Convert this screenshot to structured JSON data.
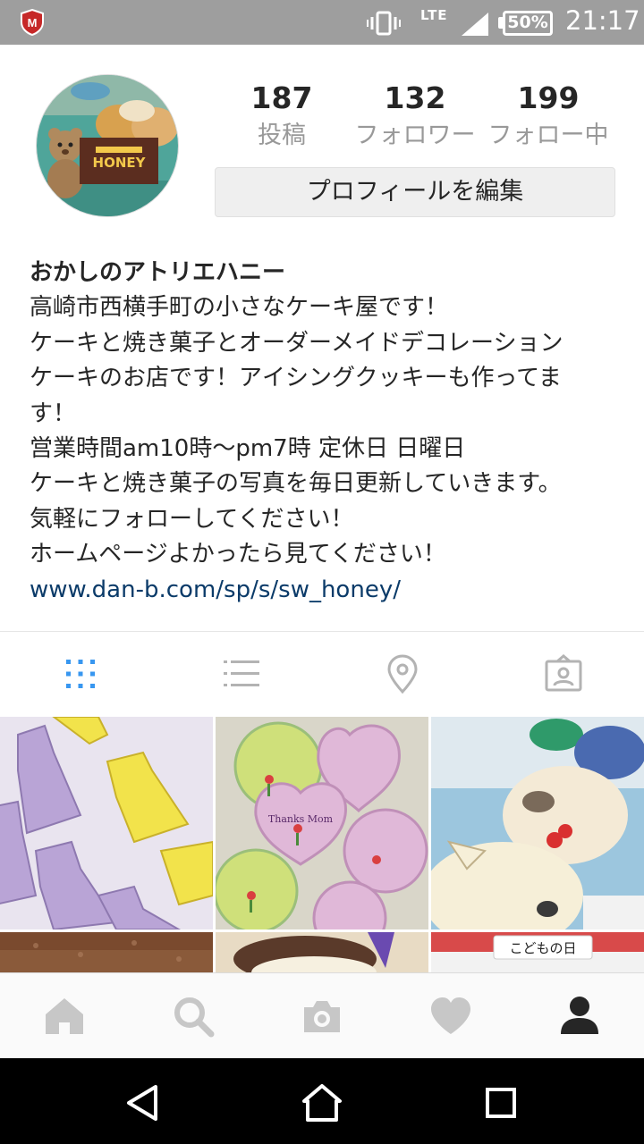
{
  "status_bar": {
    "network": "LTE",
    "battery": "50%",
    "time": "21:17"
  },
  "profile": {
    "stats": [
      {
        "value": "187",
        "label": "投稿"
      },
      {
        "value": "132",
        "label": "フォロワー"
      },
      {
        "value": "199",
        "label": "フォロー中"
      }
    ],
    "edit_button": "プロフィールを編集",
    "avatar_logo_text": "HONEY",
    "name": "おかしのアトリエハニー",
    "bio_lines": [
      "高崎市西横手町の小さなケーキ屋です！",
      "ケーキと焼き菓子とオーダーメイドデコレーション",
      "ケーキのお店です！アイシングクッキーも作ってま",
      "す！",
      "営業時間am10時〜pm7時 定休日 日曜日",
      "ケーキと焼き菓子の写真を毎日更新していきます。",
      "気軽にフォローしてください！",
      "ホームページよかったら見てください！"
    ],
    "link": "www.dan-b.com/sp/s/sw_honey/"
  },
  "view_tabs": [
    {
      "icon": "grid-icon",
      "active": true
    },
    {
      "icon": "list-icon",
      "active": false
    },
    {
      "icon": "location-pin-icon",
      "active": false
    },
    {
      "icon": "tagged-photos-icon",
      "active": false
    }
  ],
  "grid": {
    "tile_bg": [
      "#b9a4d6",
      "#9bbf7a",
      "#7fb8d8",
      "#8a5a3a",
      "#e8dbc4",
      "#f2f2f2"
    ],
    "photo_texts": [
      "Thanks Mom",
      "こどもの日"
    ]
  },
  "bottom_nav": [
    {
      "icon": "home-icon",
      "active": false
    },
    {
      "icon": "search-icon",
      "active": false
    },
    {
      "icon": "camera-icon",
      "active": false
    },
    {
      "icon": "heart-icon",
      "active": false
    },
    {
      "icon": "profile-icon",
      "active": true
    }
  ],
  "colors": {
    "status_bar": "#9e9e9e",
    "active_tab": "#3897f0",
    "link": "#0b3b69",
    "inactive_icon": "#c7c7c7"
  }
}
